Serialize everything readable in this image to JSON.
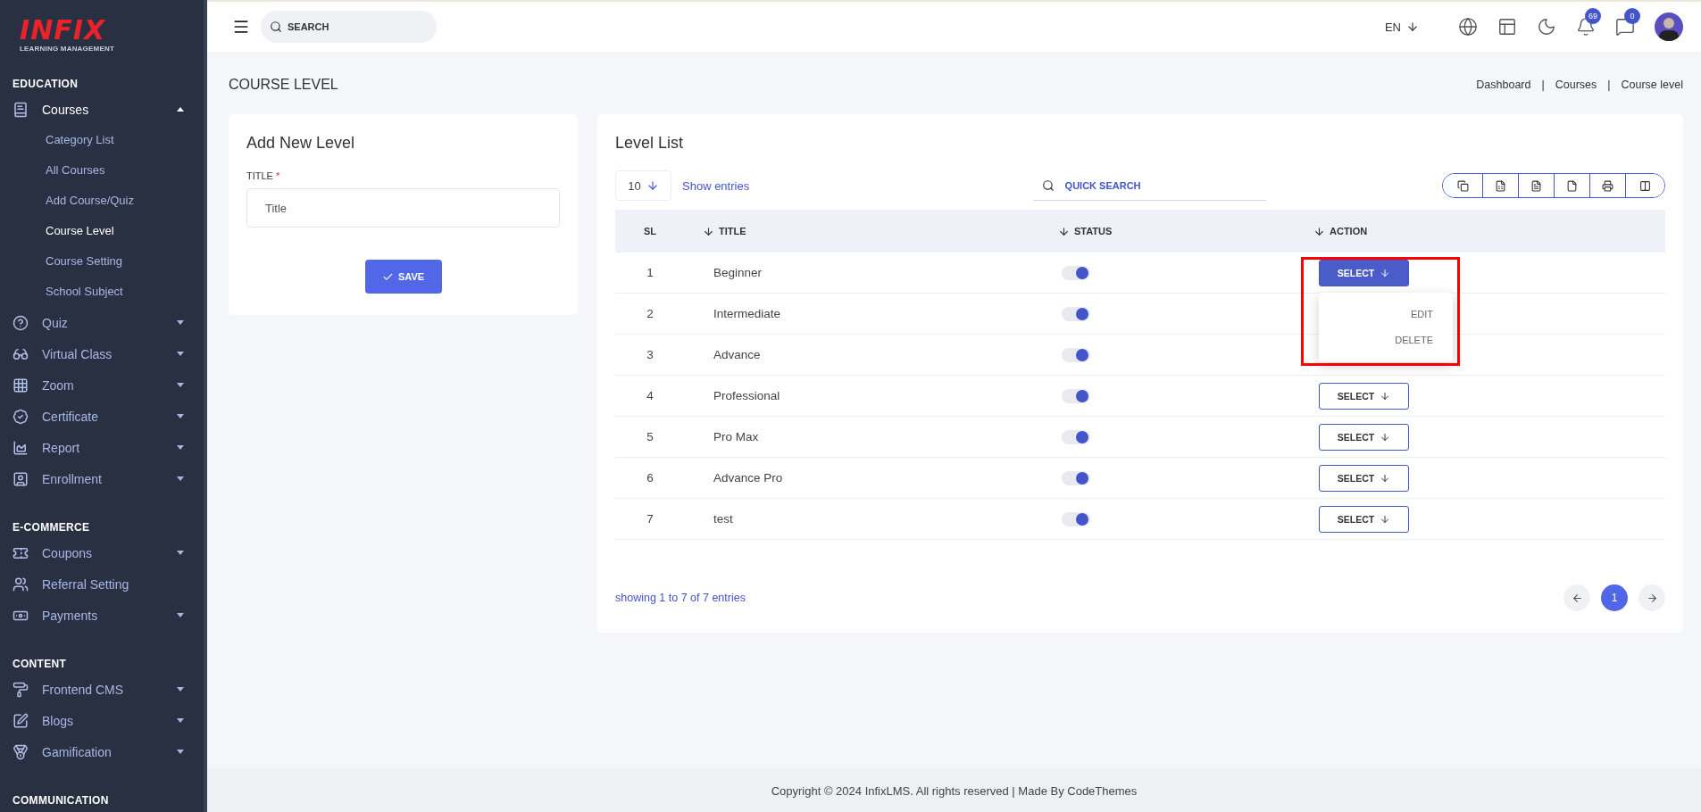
{
  "logo": {
    "wordmark": "INFIX",
    "tagline": "LEARNING MANAGEMENT"
  },
  "sidebar": {
    "sections": [
      {
        "title": "EDUCATION",
        "items": [
          {
            "label": "Courses",
            "kind": "group",
            "expanded": true,
            "children": [
              {
                "label": "Category List",
                "selected": false
              },
              {
                "label": "All Courses",
                "selected": false
              },
              {
                "label": "Add Course/Quiz",
                "selected": false
              },
              {
                "label": "Course Level",
                "selected": true
              },
              {
                "label": "Course Setting",
                "selected": false
              },
              {
                "label": "School Subject",
                "selected": false
              }
            ]
          },
          {
            "label": "Quiz",
            "kind": "group",
            "expanded": false
          },
          {
            "label": "Virtual Class",
            "kind": "group",
            "expanded": false
          },
          {
            "label": "Zoom",
            "kind": "group",
            "expanded": false
          },
          {
            "label": "Certificate",
            "kind": "group",
            "expanded": false
          },
          {
            "label": "Report",
            "kind": "group",
            "expanded": false
          },
          {
            "label": "Enrollment",
            "kind": "group",
            "expanded": false
          }
        ]
      },
      {
        "title": "E-COMMERCE",
        "items": [
          {
            "label": "Coupons",
            "kind": "group",
            "expanded": false
          },
          {
            "label": "Referral Setting",
            "kind": "link",
            "expanded": false
          },
          {
            "label": "Payments",
            "kind": "group",
            "expanded": false
          }
        ]
      },
      {
        "title": "CONTENT",
        "items": [
          {
            "label": "Frontend CMS",
            "kind": "group",
            "expanded": false
          },
          {
            "label": "Blogs",
            "kind": "group",
            "expanded": false
          },
          {
            "label": "Gamification",
            "kind": "group",
            "expanded": false
          }
        ]
      },
      {
        "title": "COMMUNICATION"
      }
    ]
  },
  "header": {
    "search": {
      "placeholder": "SEARCH"
    },
    "language": "EN",
    "notifications": "69",
    "messages": "0"
  },
  "page": {
    "title": "COURSE LEVEL",
    "breadcrumbs": [
      "Dashboard",
      "Courses",
      "Course level"
    ],
    "separator": "|"
  },
  "form": {
    "title": "Add New Level",
    "field_label": "TITLE",
    "required_mark": "*",
    "placeholder": "Title",
    "save": "SAVE"
  },
  "list": {
    "title": "Level List",
    "page_size": "10",
    "show_entries": "Show entries",
    "search_placeholder": "QUICK SEARCH",
    "columns": [
      "SL",
      "TITLE",
      "STATUS",
      "ACTION"
    ],
    "rows": [
      {
        "sl": "1",
        "title": "Beginner",
        "on": true,
        "action": "SELECT",
        "menu": [
          "EDIT",
          "DELETE"
        ]
      },
      {
        "sl": "2",
        "title": "Intermediate",
        "on": true
      },
      {
        "sl": "3",
        "title": "Advance",
        "on": true
      },
      {
        "sl": "4",
        "title": "Professional",
        "on": true,
        "action": "SELECT"
      },
      {
        "sl": "5",
        "title": "Pro Max",
        "on": true,
        "action": "SELECT"
      },
      {
        "sl": "6",
        "title": "Advance Pro",
        "on": true,
        "action": "SELECT"
      },
      {
        "sl": "7",
        "title": "test",
        "on": true,
        "action": "SELECT"
      }
    ],
    "summary": "showing 1 to 7 of 7 entries",
    "pages": [
      {
        "label": "1",
        "selected": true
      }
    ]
  },
  "footer": "Copyright © 2024 InfixLMS. All rights reserved | Made By CodeThemes"
}
